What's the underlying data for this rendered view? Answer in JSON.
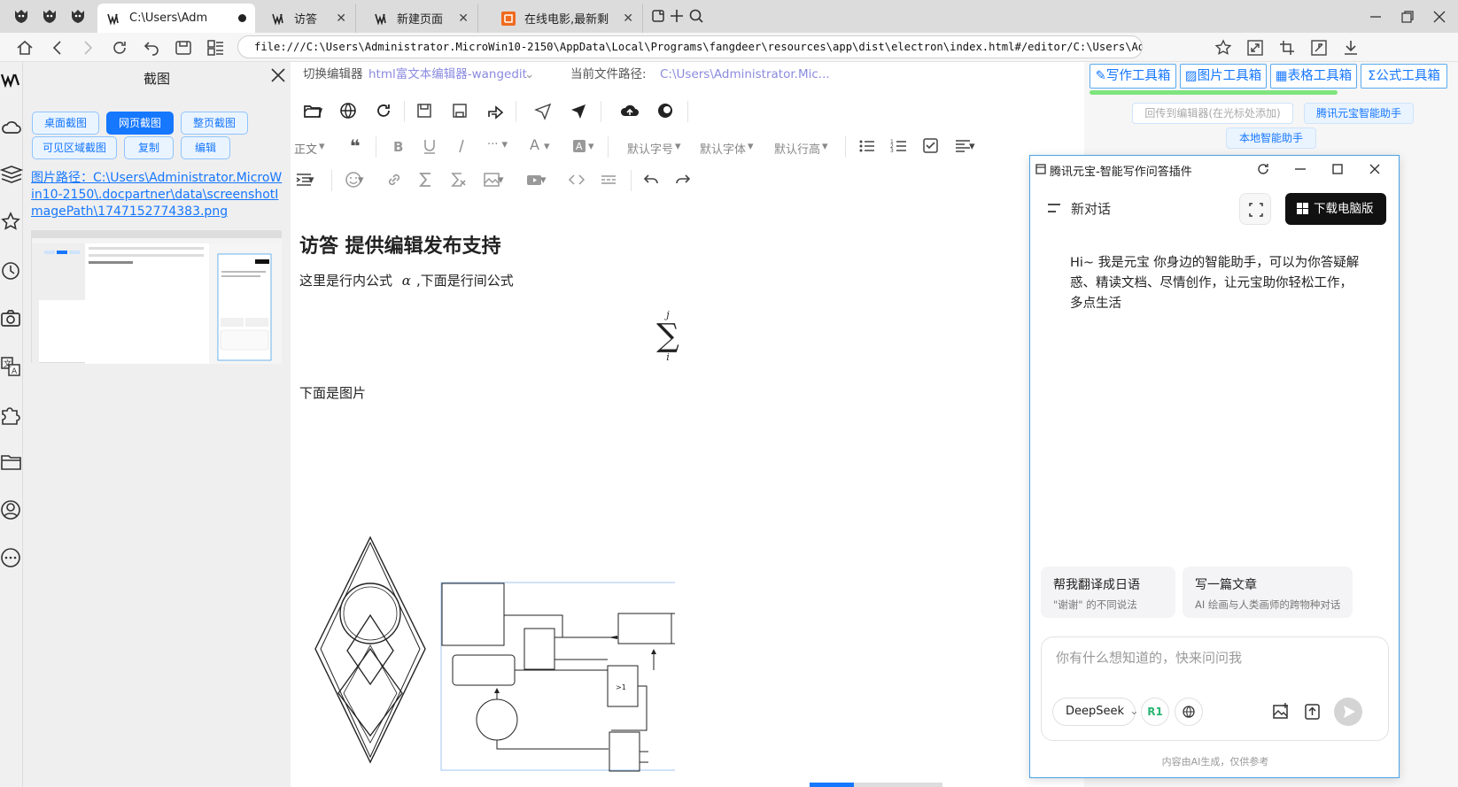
{
  "browser": {
    "tabs": [
      {
        "label": "C:\\Users\\Adm",
        "active": true,
        "close_mark": "●"
      },
      {
        "label": "访答",
        "close_mark": "✕"
      },
      {
        "label": "新建页面",
        "close_mark": "✕"
      },
      {
        "label": "在线电影,最新剩",
        "close_mark": "✕"
      }
    ],
    "url": "file:///C:\\Users\\Administrator.MicroWin10-2150\\AppData\\Local\\Programs\\fangdeer\\resources\\app\\dist\\electron\\index.html#/editor/C:\\Users\\Admin"
  },
  "screenshot_panel": {
    "title": "截图",
    "buttons": [
      "桌面截图",
      "网页截图",
      "整页截图",
      "可见区域截图",
      "复制",
      "编辑"
    ],
    "selected_button": "网页截图",
    "path_label": "图片路径：C:\\Users\\Administrator.MicroWin10-2150\\.docpartner\\data\\screenshotImagePath\\1747152774383.png"
  },
  "editor": {
    "switch_label": "切换编辑器",
    "editor_name": "html富文本编辑器-wangedit",
    "path_label": "当前文件路径:",
    "path_value": "C:\\Users\\Administrator.Mic...",
    "toolbar_text": {
      "para": "正文",
      "fontsize": "默认字号",
      "fontfamily": "默认字体",
      "lineheight": "默认行高"
    },
    "doc": {
      "heading": "访答 提供编辑发布支持",
      "p1_before": "这里是行内公式",
      "p1_formula": "α",
      "p1_after": ",下面是行间公式",
      "sum_top": "j",
      "sum_bottom": "i",
      "p2": "下面是图片",
      "flow_gate": ">1"
    }
  },
  "right_panel": {
    "tabs": [
      "写作工具箱",
      "图片工具箱",
      "表格工具箱",
      "公式工具箱"
    ],
    "buttons": [
      "回传到编辑器(在光标处添加)",
      "腾讯元宝智能助手",
      "本地智能助手"
    ]
  },
  "chat": {
    "title": "腾讯元宝-智能写作问答插件",
    "new_chat": "新对话",
    "download": "下载电脑版",
    "greeting": "Hi~ 我是元宝 你身边的智能助手，可以为你答疑解惑、精读文档、尽情创作，让元宝助你轻松工作，多点生活",
    "suggestions": [
      {
        "title": "帮我翻译成日语",
        "sub": "\"谢谢\" 的不同说法"
      },
      {
        "title": "写一篇文章",
        "sub": "AI 绘画与人类画师的跨物种对话"
      }
    ],
    "input_placeholder": "你有什么想知道的，快来问问我",
    "model": "DeepSeek",
    "r1": "R1",
    "disclaimer": "内容由AI生成，仅供参考"
  },
  "colors": {
    "accent": "#1677ff",
    "chat_border": "#4aa3e8",
    "green_bar": "#7ee57e"
  }
}
